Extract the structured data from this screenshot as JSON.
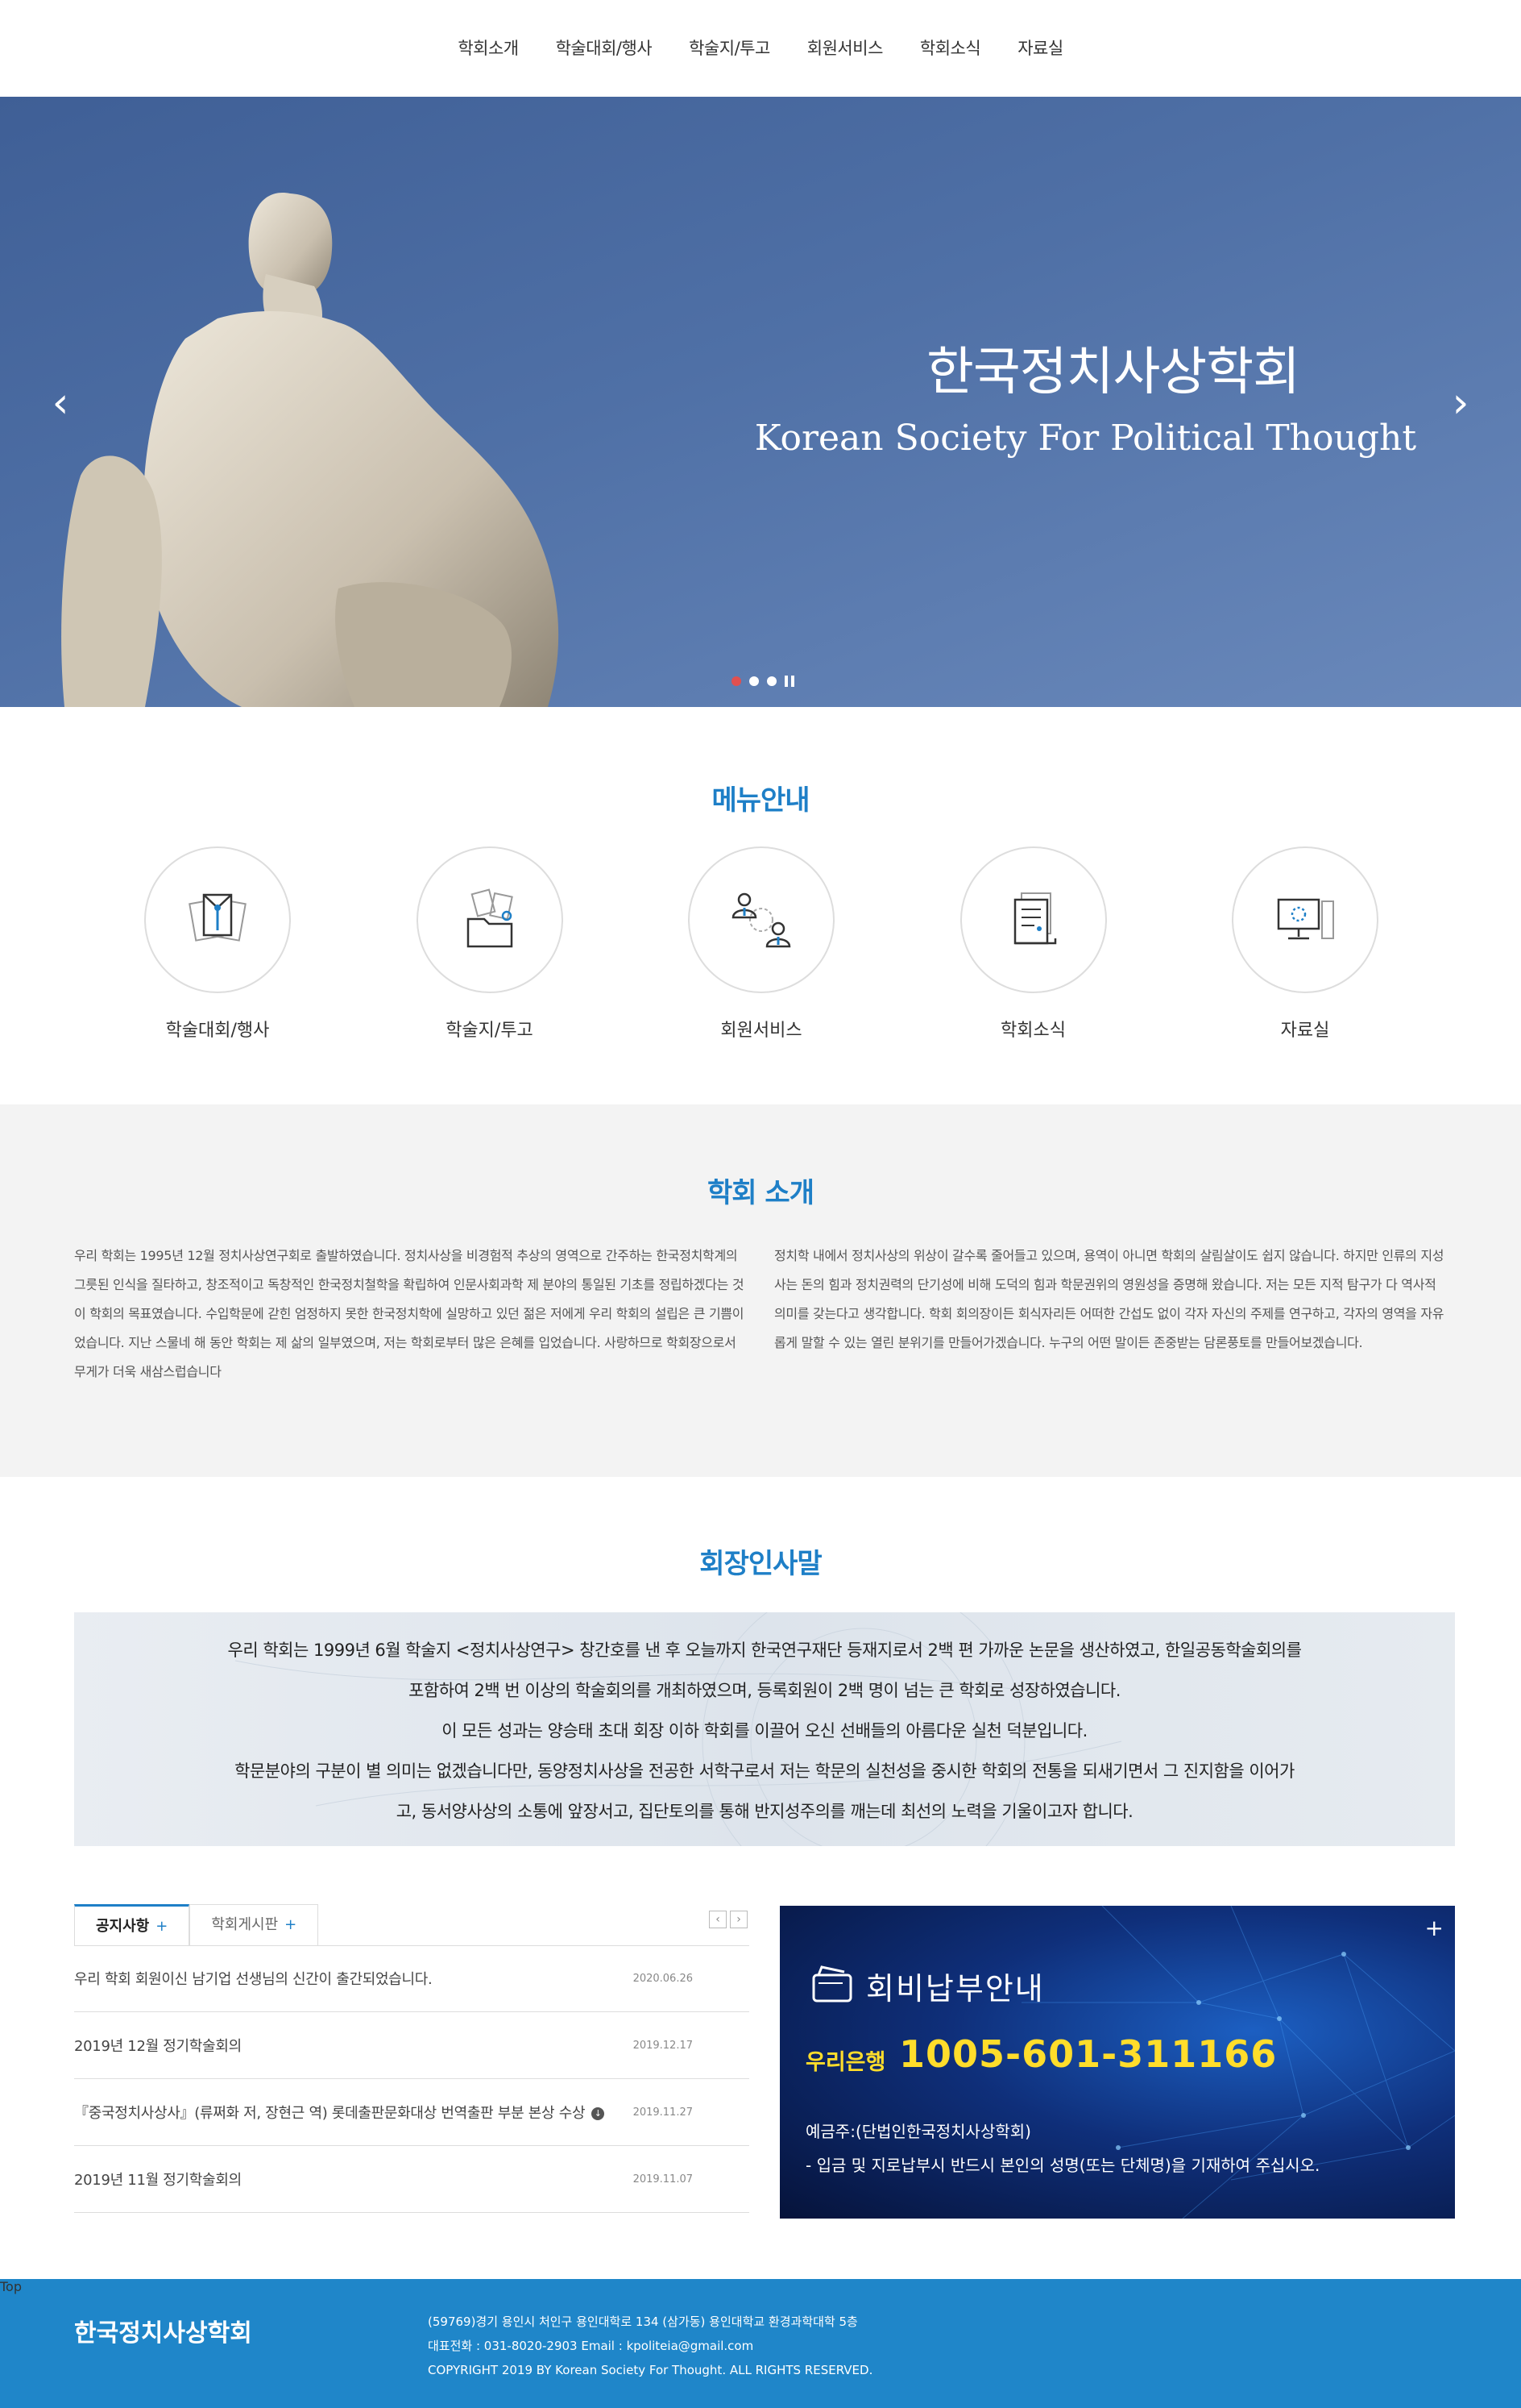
{
  "nav": {
    "items": [
      "학회소개",
      "학술대회/행사",
      "학술지/투고",
      "회원서비스",
      "학회소식",
      "자료실"
    ]
  },
  "hero": {
    "title_ko": "한국정치사상학회",
    "title_en": "Korean Society For Political Thought",
    "slides": 3,
    "active_slide": 1
  },
  "menu_guide": {
    "title": "메뉴안내",
    "items": [
      {
        "label": "학술대회/행사",
        "icon": "documents-icon"
      },
      {
        "label": "학술지/투고",
        "icon": "folder-icon"
      },
      {
        "label": "회원서비스",
        "icon": "members-icon"
      },
      {
        "label": "학회소식",
        "icon": "newspaper-icon"
      },
      {
        "label": "자료실",
        "icon": "computer-icon"
      }
    ]
  },
  "intro": {
    "title": "학회 소개",
    "left": "우리 학회는 1995년 12월 정치사상연구회로 출발하였습니다. 정치사상을 비경험적 추상의 영역으로 간주하는 한국정치학계의 그릇된 인식을 질타하고, 창조적이고 독창적인 한국정치철학을 확립하여 인문사회과학 제 분야의 통일된 기초를 정립하겠다는 것이 학회의 목표였습니다. 수입학문에 갇힌 엄정하지 못한 한국정치학에 실망하고 있던 젊은 저에게 우리 학회의 설립은 큰 기쁨이었습니다. 지난 스물네 해 동안 학회는 제 삶의 일부였으며, 저는 학회로부터 많은 은혜를 입었습니다. 사랑하므로 학회장으로서 무게가 더욱 새삼스럽습니다",
    "right": "정치학 내에서 정치사상의 위상이 갈수록 줄어들고 있으며, 용역이 아니면 학회의 살림살이도 쉽지 않습니다. 하지만 인류의 지성사는 돈의 힘과 정치권력의 단기성에 비해 도덕의 힘과 학문권위의 영원성을 증명해 왔습니다. 저는 모든 지적 탐구가 다 역사적 의미를 갖는다고 생각합니다. 학회 회의장이든 회식자리든 어떠한 간섭도 없이 각자 자신의 주제를 연구하고, 각자의 영역을 자유롭게 말할 수 있는 열린 분위기를 만들어가겠습니다. 누구의 어떤 말이든 존중받는 담론풍토를 만들어보겠습니다."
  },
  "greeting": {
    "title": "회장인사말",
    "lines": [
      "우리 학회는 1999년 6월 학술지 <정치사상연구> 창간호를 낸 후 오늘까지 한국연구재단 등재지로서 2백 편 가까운 논문을 생산하였고, 한일공동학술회의를",
      "포함하여 2백 번 이상의 학술회의를 개최하였으며, 등록회원이 2백 명이 넘는 큰 학회로 성장하였습니다.",
      "이 모든 성과는 양승태 초대 회장 이하 학회를 이끌어 오신 선배들의 아름다운 실천 덕분입니다.",
      "학문분야의 구분이 별 의미는 없겠습니다만, 동양정치사상을 전공한 서학구로서 저는 학문의 실천성을 중시한 학회의 전통을 되새기면서 그 진지함을 이어가",
      "고, 동서양사상의 소통에 앞장서고, 집단토의를 통해 반지성주의를 깨는데 최선의 노력을 기울이고자 합니다."
    ]
  },
  "board": {
    "tabs": [
      {
        "label": "공지사항",
        "plus": "+"
      },
      {
        "label": "학회게시판",
        "plus": "+"
      }
    ],
    "pager": [
      "‹",
      "›"
    ],
    "notices": [
      {
        "title": "우리 학회 회원이신 남기업 선생님의 신간이 출간되었습니다.",
        "date": "2020.06.26"
      },
      {
        "title": "2019년 12월 정기학술회의",
        "date": "2019.12.17"
      },
      {
        "title": "『중국정치사상사』(류쩌화 저, 장현근 역) 롯데출판문화대상 번역출판 부분 본상 수상",
        "date": "2019.11.27",
        "attachment": true
      },
      {
        "title": "2019년 11월 정기학술회의",
        "date": "2019.11.07"
      }
    ]
  },
  "bank": {
    "title": "회비납부안내",
    "bank_name": "우리은행",
    "account": "1005-601-311166",
    "holder": "예금주:(단법인한국정치사상학회)",
    "note": "- 입금 및 지로납부시 반드시 본인의 성명(또는 단체명)을 기재하여 주십시오.",
    "plus": "+"
  },
  "footer": {
    "name": "한국정치사상학회",
    "address": "(59769)경기 용인시 처인구 용인대학로 134 (삼가동) 용인대학교 환경과학대학 5층",
    "contact": "대표전화 : 031-8020-2903      Email : kpoliteia@gmail.com",
    "copyright": "COPYRIGHT 2019 BY Korean Society For Thought. ALL RIGHTS RESERVED.",
    "top": "Top"
  },
  "colors": {
    "accent": "#1e7fc7",
    "footer": "#1f86c9",
    "bank_highlight": "#ffdd2b",
    "slider_active": "#e05050"
  }
}
